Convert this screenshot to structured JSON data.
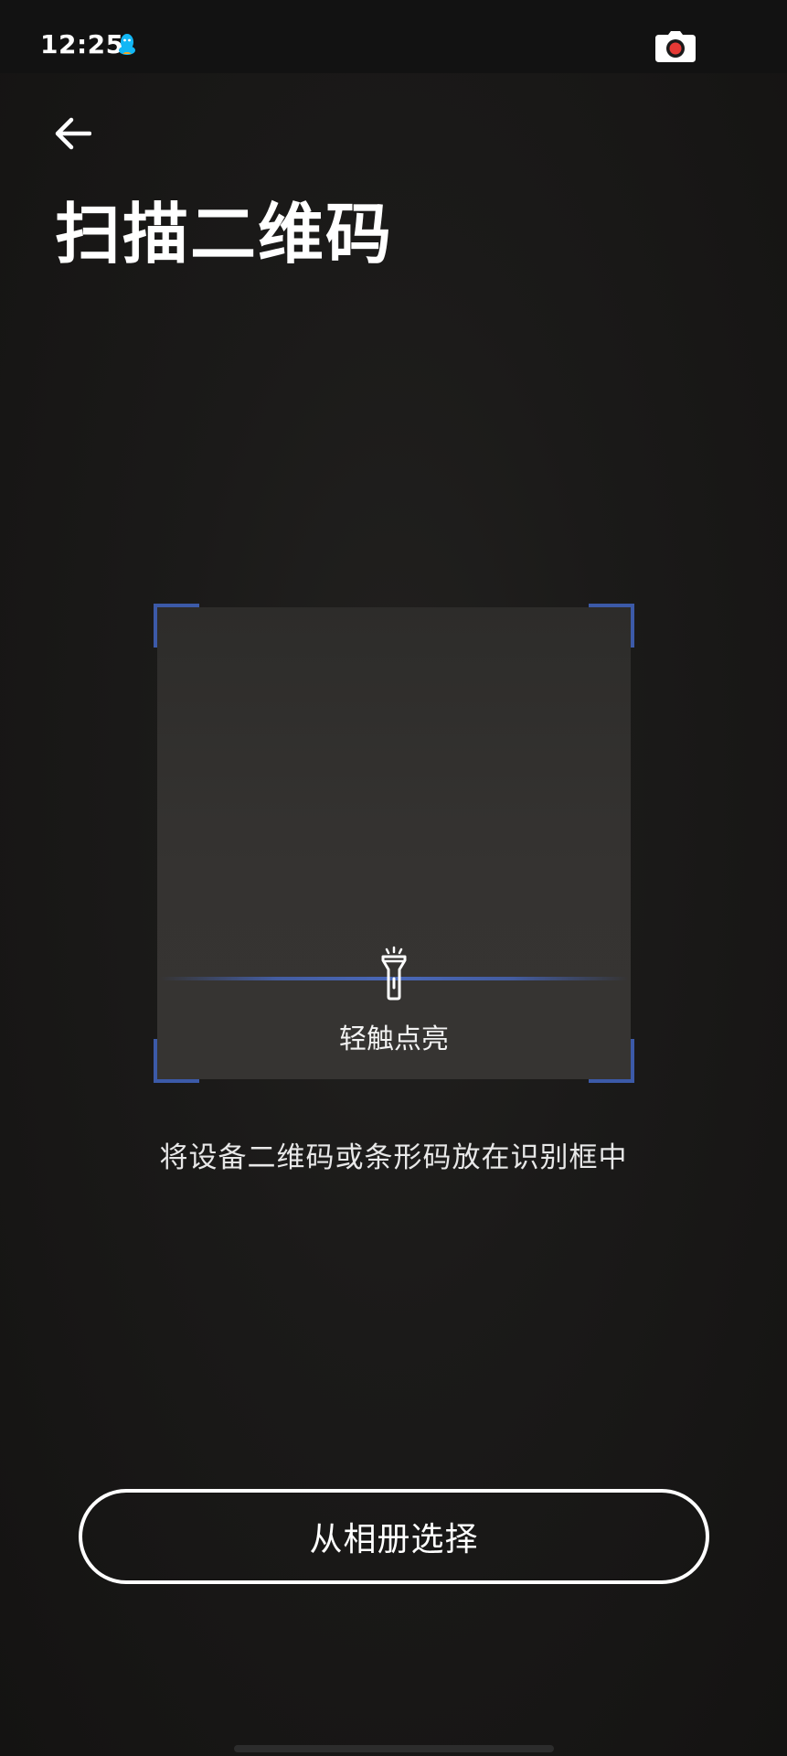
{
  "status_bar": {
    "time": "12:25",
    "notification_icon": "qq-penguin-icon",
    "camera_indicator_icon": "camera-recording-icon"
  },
  "header": {
    "back_icon": "arrow-left-icon",
    "title": "扫描二维码"
  },
  "scanner": {
    "accent_color": "#3c5aa8",
    "flashlight_icon": "flashlight-icon",
    "flashlight_label": "轻触点亮",
    "hint": "将设备二维码或条形码放在识别框中"
  },
  "actions": {
    "album_button_label": "从相册选择"
  }
}
